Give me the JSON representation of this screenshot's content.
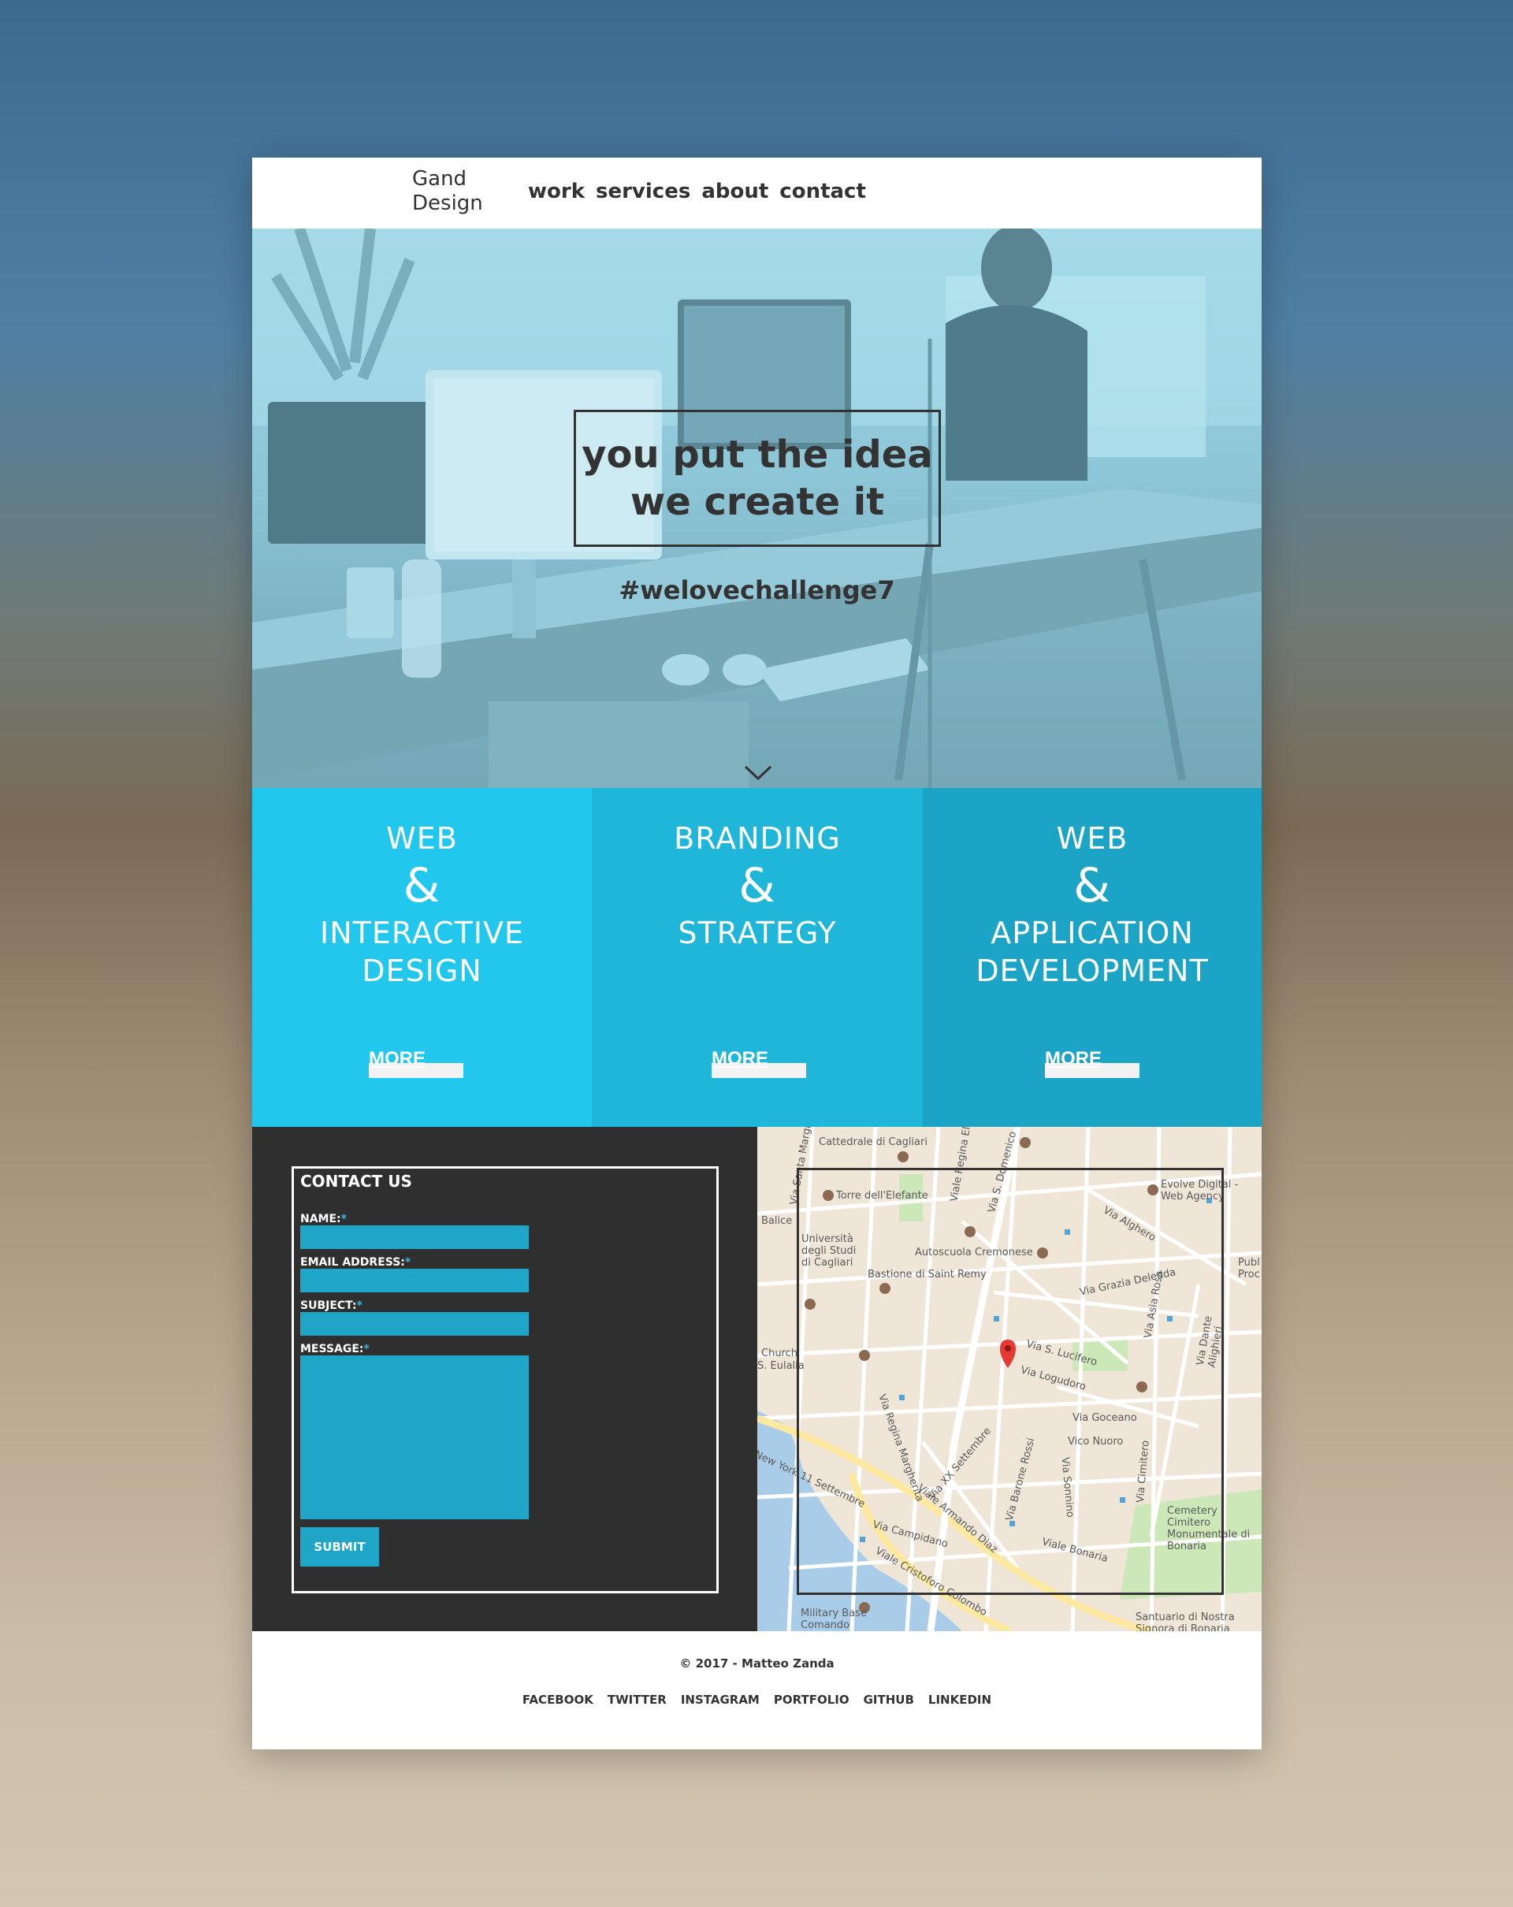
{
  "nav": {
    "logo_line1": "Gand",
    "logo_line2": "Design",
    "links": [
      "work",
      "services",
      "about",
      "contact"
    ]
  },
  "hero": {
    "tagline_line1": "you put the idea",
    "tagline_line2": "we create it",
    "hashtag": "#welovechallenge7",
    "scroll_icon": "chevron-down-icon"
  },
  "services": [
    {
      "title_top": "WEB",
      "amp": "&",
      "title_bottom_1": "INTERACTIVE",
      "title_bottom_2": "DESIGN",
      "more": "MORE",
      "color": "#22c7ee"
    },
    {
      "title_top": "BRANDING",
      "amp": "&",
      "title_bottom_1": "STRATEGY",
      "title_bottom_2": "",
      "more": "MORE",
      "color": "#1fb6da"
    },
    {
      "title_top": "WEB",
      "amp": "&",
      "title_bottom_1": "APPLICATION",
      "title_bottom_2": "DEVELOPMENT",
      "more": "MORE",
      "color": "#1ca4c6"
    }
  ],
  "contact": {
    "title": "CONTACT US",
    "name_label": "NAME:",
    "email_label": "EMAIL ADDRESS:",
    "subject_label": "SUBJECT:",
    "message_label": "MESSAGE:",
    "required_mark": "*",
    "submit": "SUBMIT"
  },
  "map": {
    "labels": [
      "Cattedrale di Cagliari",
      "Torre dell'Elefante",
      "Università degli Studi di Cagliari",
      "Autoscuola Cremonese",
      "Bastione di Saint Remy",
      "Evolve Digital - Web Agency",
      "Via Alghero",
      "Via Grazia Deledda",
      "Via S. Lucifero",
      "Via Logudoro",
      "Via Goceano",
      "Vico Nuoro",
      "Via Regina Margherita",
      "Via XX Settembre",
      "Viale Armando Diaz",
      "Via Campidano",
      "Viale Cristoforo Colombo",
      "Viale Bonaria",
      "Cemetery Cimitero Monumentale di Bonaria",
      "Military Base Comando Supporto",
      "Santuario di Nostra Signora di Bonaria",
      "New York 11 Settembre",
      "Via Dante Alighieri",
      "Via Cimitero",
      "Via Barone Rossi",
      "Via Sonnino",
      "Via Asia Rosa",
      "Via S. Domenico",
      "Viale Regina Elena",
      "Via Santa Margherita",
      "Balice",
      "S. Eulalia",
      "Church",
      "Publ Proc"
    ]
  },
  "footer": {
    "copyright": "© 2017 - Matteo Zanda",
    "links": [
      "FACEBOOK",
      "TWITTER",
      "INSTAGRAM",
      "PORTFOLIO",
      "GITHUB",
      "LINKEDIN"
    ]
  }
}
